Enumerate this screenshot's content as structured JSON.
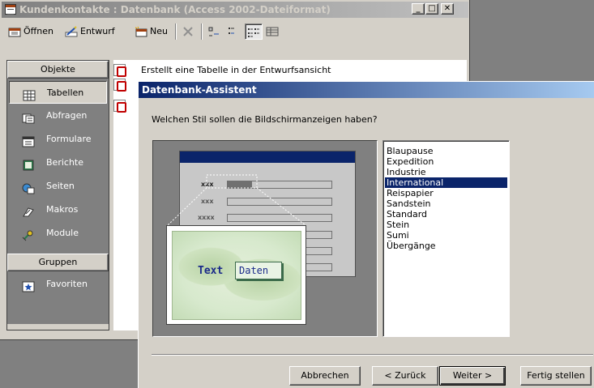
{
  "db_window": {
    "title": "Kundenkontakte : Datenbank (Access 2002-Dateiformat)",
    "toolbar": {
      "open_label": "Öffnen",
      "design_label": "Entwurf",
      "new_label": "Neu"
    },
    "objects_header": "Objekte",
    "objects": [
      {
        "label": "Tabellen",
        "selected": true
      },
      {
        "label": "Abfragen"
      },
      {
        "label": "Formulare"
      },
      {
        "label": "Berichte"
      },
      {
        "label": "Seiten"
      },
      {
        "label": "Makros"
      },
      {
        "label": "Module"
      }
    ],
    "groups_header": "Gruppen",
    "groups": [
      {
        "label": "Favoriten"
      }
    ],
    "list_items": [
      "Erstellt eine Tabelle in der Entwurfsansicht"
    ]
  },
  "wizard": {
    "title": "Datenbank-Assistent",
    "question": "Welchen Stil sollen die Bildschirmanzeigen haben?",
    "styles": [
      "Blaupause",
      "Expedition",
      "Industrie",
      "International",
      "Reispapier",
      "Sandstein",
      "Standard",
      "Stein",
      "Sumi",
      "Übergänge"
    ],
    "selected_style": "International",
    "preview": {
      "label_text": "Text",
      "field_text": "Daten",
      "field_labels": [
        "xxx",
        "xxx",
        "xxxx"
      ]
    },
    "buttons": {
      "cancel": "Abbrechen",
      "back": "< Zurück",
      "next": "Weiter >",
      "finish": "Fertig stellen"
    }
  },
  "colors": {
    "active_title": "#0a246a",
    "inactive_title": "#808080",
    "face": "#d4d0c8",
    "selection": "#0a246a"
  }
}
